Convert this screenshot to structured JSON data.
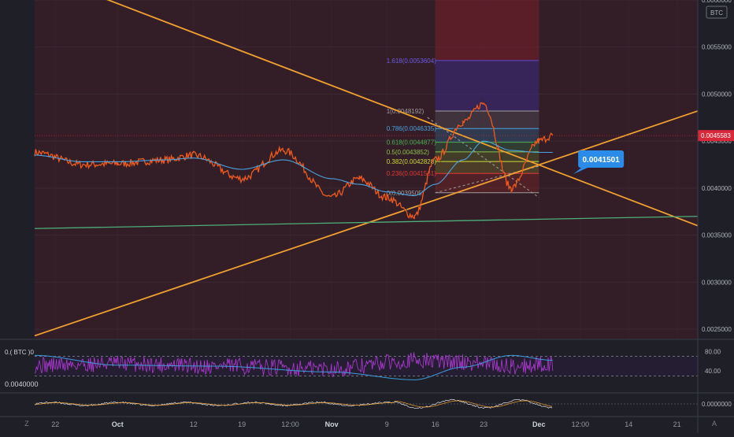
{
  "colors": {
    "background": "#1e1f27",
    "main_pane": "#331d27",
    "gridline": "#3a2a33",
    "price_line": "#f25a1e",
    "ma_line": "#4aa3df",
    "trendline": "#f0a030",
    "support_line": "#4caf7a",
    "rsi_line": "#b03ad6",
    "rsi_ma_line": "#3d9be0",
    "callout": "#2b8be8",
    "price_tag": "#d8283a"
  },
  "main_axis": {
    "currency_badge": "BTC",
    "ylim": [
      0.0024,
      0.006
    ],
    "ticks": [
      "0.0060000",
      "0.0055000",
      "0.0050000",
      "0.0045000",
      "0.0040000",
      "0.0035000",
      "0.0030000",
      "0.0025000"
    ],
    "tick_values": [
      0.006,
      0.0055,
      0.005,
      0.0045,
      0.004,
      0.0035,
      0.003,
      0.0025
    ],
    "last_price_label": "0.0045583",
    "last_price": 0.0045583
  },
  "callout": {
    "label": "0.0041501",
    "value": 0.0041501
  },
  "rsi_pane": {
    "left_label_top": "0.( BTC )0",
    "left_label_bottom": "0.0040000",
    "ticks": [
      "80.00",
      "40.00"
    ],
    "tick_values": [
      80,
      40
    ],
    "upper_band": 70,
    "lower_band": 30,
    "ylim": [
      0,
      100
    ]
  },
  "macd_pane": {
    "ticks": [
      "0.0000000"
    ],
    "tick_values": [
      0
    ]
  },
  "time_axis": {
    "labels": [
      "22",
      "Oct",
      "12",
      "19",
      "12:00",
      "Nov",
      "9",
      "16",
      "23",
      "Dec",
      "12:00",
      "14",
      "21"
    ],
    "bold_labels": [
      "Oct",
      "Nov",
      "Dec"
    ],
    "zoom_left": "Z",
    "zoom_right": "A"
  },
  "chart_data": [
    {
      "type": "line",
      "title": "",
      "x_domain": [
        "Sep 19",
        "Dec 24"
      ],
      "ylim": [
        0.0024,
        0.006
      ],
      "series": [],
      "x": [
        "Sep 19",
        "Sep 26",
        "Oct 1",
        "Oct 8",
        "Oct 12",
        "Oct 19",
        "Oct 25",
        "Nov 1",
        "Nov 5",
        "Nov 9",
        "Nov 13",
        "Nov 16",
        "Nov 20",
        "Nov 23",
        "Nov 27",
        "Dec 1",
        "Dec 3"
      ],
      "values": [
        0.00438,
        0.00425,
        0.00426,
        0.0043,
        0.00435,
        0.0041,
        0.0044,
        0.0039,
        0.0041,
        0.0039,
        0.0037,
        0.0043,
        0.0047,
        0.0049,
        0.004,
        0.0045,
        0.00456
      ],
      "moving_average": [
        0.00435,
        0.00428,
        0.00428,
        0.0043,
        0.00432,
        0.0042,
        0.0043,
        0.0041,
        0.00404,
        0.00396,
        0.00392,
        0.00404,
        0.0043,
        0.0045,
        0.0044,
        0.00438,
        0.00438
      ],
      "fibonacci": {
        "x_range": [
          "Nov 16",
          "Dec 1"
        ],
        "extension_label": "1.618(0.0053604)",
        "levels": [
          {
            "label": "1(0.0048192)",
            "ratio": 1,
            "value": 0.0048192,
            "color": "#9e9e9e"
          },
          {
            "label": "0.786(0.0046335)",
            "ratio": 0.786,
            "value": 0.0046335,
            "color": "#4aa3df"
          },
          {
            "label": "0.618(0.0044877)",
            "ratio": 0.618,
            "value": 0.0044877,
            "color": "#4caf50"
          },
          {
            "label": "0.5(0.0043852)",
            "ratio": 0.5,
            "value": 0.0043852,
            "color": "#8bc34a"
          },
          {
            "label": "0.382(0.0042828)",
            "ratio": 0.382,
            "value": 0.0042828,
            "color": "#cddc39"
          },
          {
            "label": "0.236(0.0041561)",
            "ratio": 0.236,
            "value": 0.0041561,
            "color": "#e53935"
          },
          {
            "label": "0(0.0039505)",
            "ratio": 0,
            "value": 0.0039505,
            "color": "#9e9e9e"
          }
        ]
      },
      "extension_zone_top": 0.006,
      "trendlines": [
        {
          "name": "descending",
          "from": [
            "Sep 19",
            0.0063
          ],
          "to": [
            "Dec 24",
            0.0036
          ]
        },
        {
          "name": "ascending",
          "from": [
            "Sep 19",
            0.00243
          ],
          "to": [
            "Dec 24",
            0.00482
          ]
        },
        {
          "name": "support",
          "from": [
            "Sep 19",
            0.00357
          ],
          "to": [
            "Dec 24",
            0.0037
          ]
        }
      ]
    },
    {
      "type": "line",
      "title": "",
      "ylim": [
        0,
        100
      ],
      "series": [],
      "x": [
        "Sep 19",
        "Oct 1",
        "Oct 15",
        "Nov 1",
        "Nov 13",
        "Nov 20",
        "Nov 27",
        "Dec 3"
      ],
      "values": [
        52,
        55,
        50,
        45,
        62,
        58,
        50,
        55
      ],
      "moving_average": [
        72,
        52,
        50,
        38,
        22,
        48,
        72,
        62
      ]
    }
  ]
}
